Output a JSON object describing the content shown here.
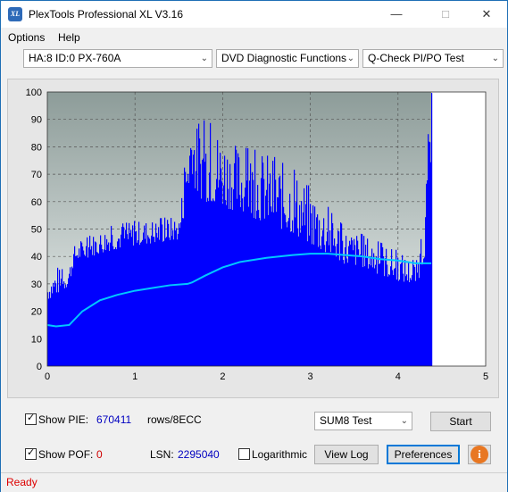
{
  "window": {
    "title": "PlexTools Professional XL V3.16",
    "icon_label": "XL",
    "controls": [
      "minimize-icon",
      "maximize-icon",
      "close-icon"
    ]
  },
  "menu": {
    "options": "Options",
    "help": "Help"
  },
  "toolbar": {
    "drive": "HA:8 ID:0  PX-760A",
    "function": "DVD Diagnostic Functions",
    "test": "Q-Check PI/PO Test"
  },
  "chart_data": {
    "type": "bar",
    "xlim": [
      0,
      5
    ],
    "ylim": [
      0,
      100
    ],
    "x_ticks": [
      "0",
      "1",
      "2",
      "3",
      "4",
      "5"
    ],
    "y_ticks": [
      "0",
      "10",
      "20",
      "30",
      "40",
      "50",
      "60",
      "70",
      "80",
      "90",
      "100"
    ],
    "grid": true,
    "data_end_x": 4.38,
    "colors": {
      "bars": "#0000ff",
      "line": "#00c8ff",
      "background": "#8fa4a0"
    },
    "series": [
      {
        "type": "bar",
        "x": [
          0.0,
          0.1,
          0.2,
          0.25,
          0.3,
          0.5,
          0.7,
          1.0,
          1.3,
          1.5,
          1.65,
          1.67,
          1.7,
          1.8,
          2.0,
          2.2,
          2.5,
          2.8,
          3.0,
          3.2,
          3.4,
          3.6,
          3.8,
          4.0,
          4.1,
          4.2,
          4.25,
          4.3,
          4.33,
          4.36,
          4.38
        ],
        "high": [
          32,
          36,
          35,
          38,
          44,
          48,
          51,
          53,
          54,
          55,
          100,
          92,
          88,
          90,
          85,
          80,
          78,
          72,
          65,
          58,
          50,
          48,
          45,
          42,
          40,
          38,
          45,
          55,
          80,
          100,
          100
        ],
        "low": [
          24,
          26,
          28,
          30,
          38,
          40,
          42,
          44,
          45,
          46,
          70,
          65,
          62,
          60,
          58,
          56,
          52,
          48,
          44,
          40,
          37,
          36,
          33,
          31,
          30,
          30,
          33,
          40,
          55,
          70,
          70
        ]
      },
      {
        "type": "line",
        "x": [
          0.0,
          0.1,
          0.25,
          0.4,
          0.6,
          0.8,
          1.0,
          1.2,
          1.4,
          1.6,
          1.65,
          1.8,
          2.0,
          2.2,
          2.5,
          2.8,
          3.0,
          3.2,
          3.4,
          3.6,
          3.8,
          4.0,
          4.2,
          4.38
        ],
        "y": [
          15,
          14.5,
          15,
          20,
          24,
          26,
          27.5,
          28.5,
          29.5,
          30,
          30.5,
          33,
          36,
          38,
          39.5,
          40.5,
          41,
          41,
          40.5,
          40,
          39,
          38.5,
          37.5,
          37.5
        ]
      }
    ]
  },
  "bottom": {
    "show_pie_label": "Show PIE:",
    "show_pie_value": "670411",
    "rows_unit": "rows/8ECC",
    "show_poe_label": "Show POF:",
    "show_poe_value": "0",
    "lsn_label": "LSN:",
    "lsn_value": "2295040",
    "logarithmic_label": "Logarithmic",
    "test_select": "SUM8 Test",
    "start": "Start",
    "view_log": "View Log",
    "preferences": "Preferences",
    "info_icon": "info-icon",
    "show_pie_checked": true,
    "show_poe_checked": true,
    "logarithmic_checked": false,
    "value_color_pie": "#0000c0",
    "value_color_poe": "#d00000"
  },
  "status": {
    "text": "Ready"
  }
}
